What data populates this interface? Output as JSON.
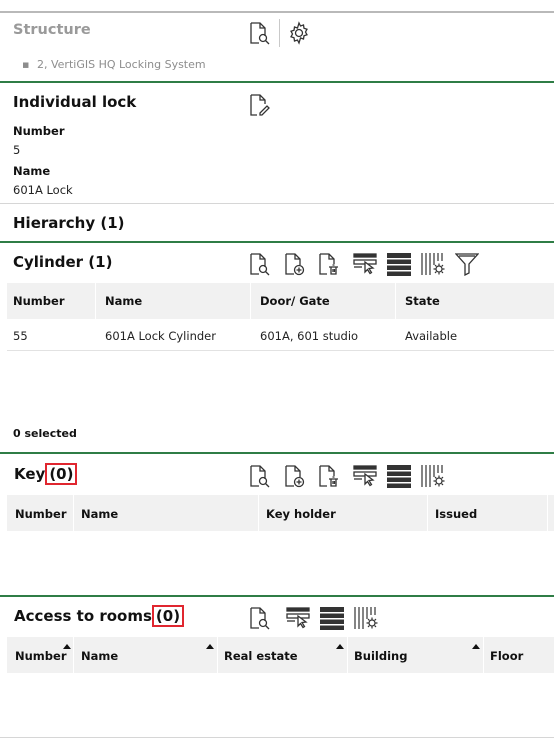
{
  "structure": {
    "title": "Structure",
    "bullet": "▪",
    "item": "2, VertiGIS HQ Locking System"
  },
  "lock": {
    "title": "Individual lock",
    "number_label": "Number",
    "number_value": "5",
    "name_label": "Name",
    "name_value": "601A Lock"
  },
  "hierarchy": {
    "title": "Hierarchy (1)"
  },
  "cylinder": {
    "title": "Cylinder (1)",
    "columns": [
      "Number",
      "Name",
      "Door/ Gate",
      "State"
    ],
    "rows": [
      [
        "55",
        "601A Lock Cylinder",
        "601A, 601 studio",
        "Available"
      ]
    ],
    "selected": "0 selected"
  },
  "key": {
    "title": "Key",
    "count": "(0)",
    "columns": [
      "Number",
      "Name",
      "Key holder",
      "Issued"
    ]
  },
  "rooms": {
    "title": "Access to rooms",
    "count": "(0)",
    "columns": [
      "Number",
      "Name",
      "Real estate",
      "Building",
      "Floor"
    ]
  },
  "colors": {
    "accent_green": "#2f7d46",
    "highlight_red": "#e0262f",
    "header_bg": "#f1f1f1"
  },
  "icons": {
    "structure": [
      "search-document-icon",
      "gear-icon"
    ],
    "lock": [
      "edit-document-icon"
    ],
    "cylinder": [
      "search-document-icon",
      "add-document-icon",
      "delete-document-icon",
      "select-rows-icon",
      "list-view-icon",
      "column-settings-icon",
      "filter-icon"
    ],
    "key": [
      "search-document-icon",
      "add-document-icon",
      "delete-document-icon",
      "select-rows-icon",
      "list-view-icon",
      "column-settings-icon"
    ],
    "rooms": [
      "search-document-icon",
      "select-rows-icon",
      "list-view-icon",
      "column-settings-icon"
    ]
  }
}
